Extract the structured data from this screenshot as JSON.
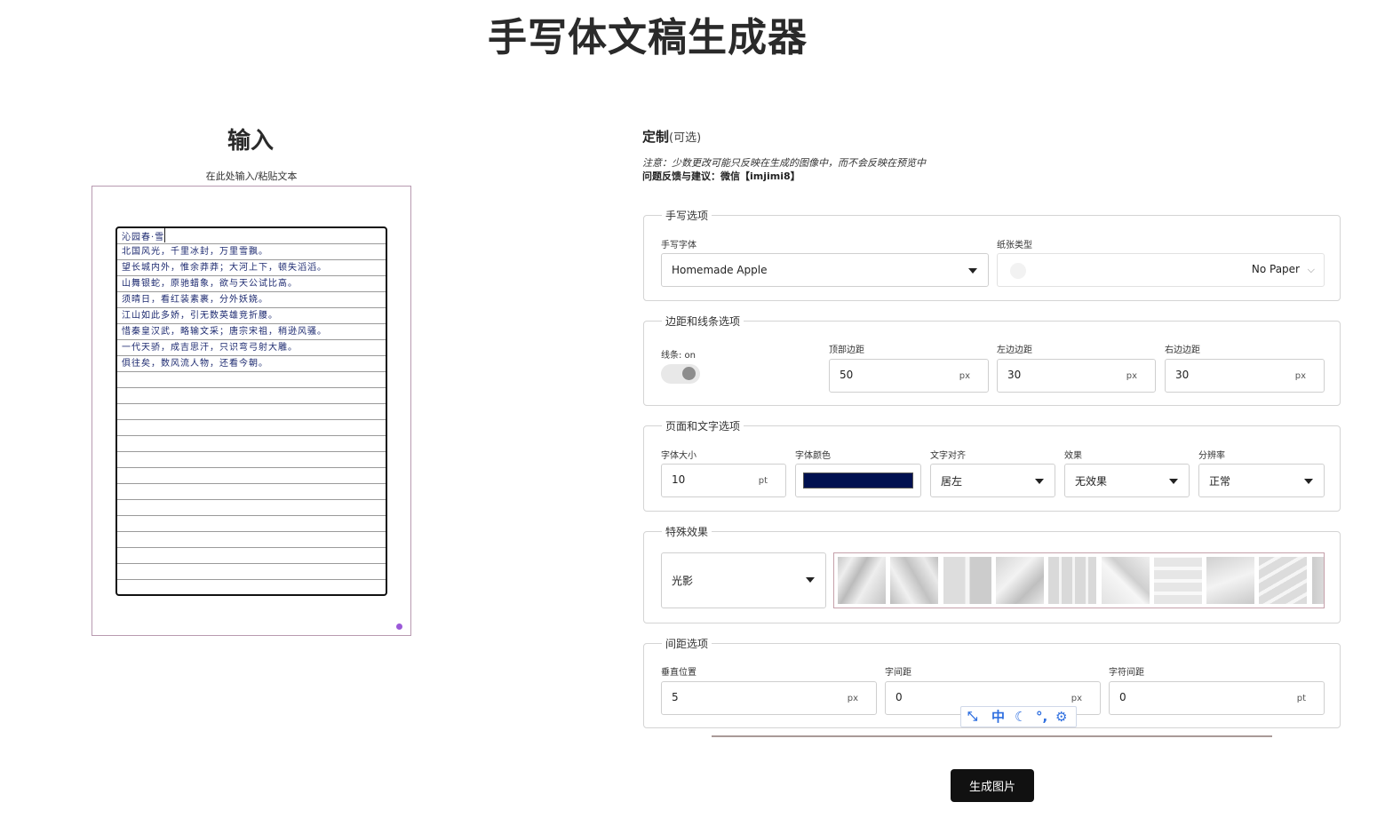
{
  "app": {
    "title": "手写体文稿生成器"
  },
  "input": {
    "heading": "输入",
    "hint": "在此处输入/粘贴文本",
    "lines": [
      "沁园春·雪",
      "北国风光，千里冰封，万里雪飘。",
      "望长城内外，惟余莽莽；大河上下，顿失滔滔。",
      "山舞银蛇，原驰蜡象，欲与天公试比高。",
      "须晴日，看红装素裹，分外妖娆。",
      "江山如此多娇，引无数英雄竞折腰。",
      "惜秦皇汉武，略输文采；唐宗宋祖，稍逊风骚。",
      "一代天骄，成吉思汗，只识弯弓射大雕。",
      "俱往矣，数风流人物，还看今朝。"
    ]
  },
  "custom": {
    "heading": "定制",
    "optional": "(可选)",
    "note": "注意：少数更改可能只反映在生成的图像中，而不会反映在预览中",
    "feedback": "问题反馈与建议：微信【imjimi8】"
  },
  "handwriting": {
    "legend": "手写选项",
    "font_label": "手写字体",
    "font_value": "Homemade Apple",
    "paper_label": "纸张类型",
    "paper_value": "No Paper"
  },
  "margins": {
    "legend": "边距和线条选项",
    "lines_label": "线条: on",
    "lines_on": true,
    "top_label": "顶部边距",
    "top_value": "50",
    "left_label": "左边边距",
    "left_value": "30",
    "right_label": "右边边距",
    "right_value": "30",
    "unit": "px"
  },
  "page_text": {
    "legend": "页面和文字选项",
    "size_label": "字体大小",
    "size_value": "10",
    "size_unit": "pt",
    "color_label": "字体颜色",
    "color_value": "#001050",
    "align_label": "文字对齐",
    "align_value": "居左",
    "effect_label": "效果",
    "effect_value": "无效果",
    "resolution_label": "分辨率",
    "resolution_value": "正常"
  },
  "special": {
    "legend": "特殊效果",
    "value": "光影",
    "thumbnail_count": 10
  },
  "spacing": {
    "legend": "间距选项",
    "vertical_label": "垂直位置",
    "vertical_value": "5",
    "vertical_unit": "px",
    "word_label": "字间距",
    "word_value": "0",
    "word_unit": "px",
    "char_label": "字符间距",
    "char_value": "0",
    "char_unit": "pt"
  },
  "toolbar": {
    "items": [
      "expand-icon",
      "中",
      "moon-icon",
      "punctuation-icon",
      "gear-icon"
    ],
    "zh_label": "中"
  },
  "generate_button": "生成图片",
  "colors": {
    "ink": "#1d2a70",
    "accent_dot": "#9b59d8",
    "toolbar_blue": "#2f6fe0",
    "button_bg": "#111111"
  }
}
